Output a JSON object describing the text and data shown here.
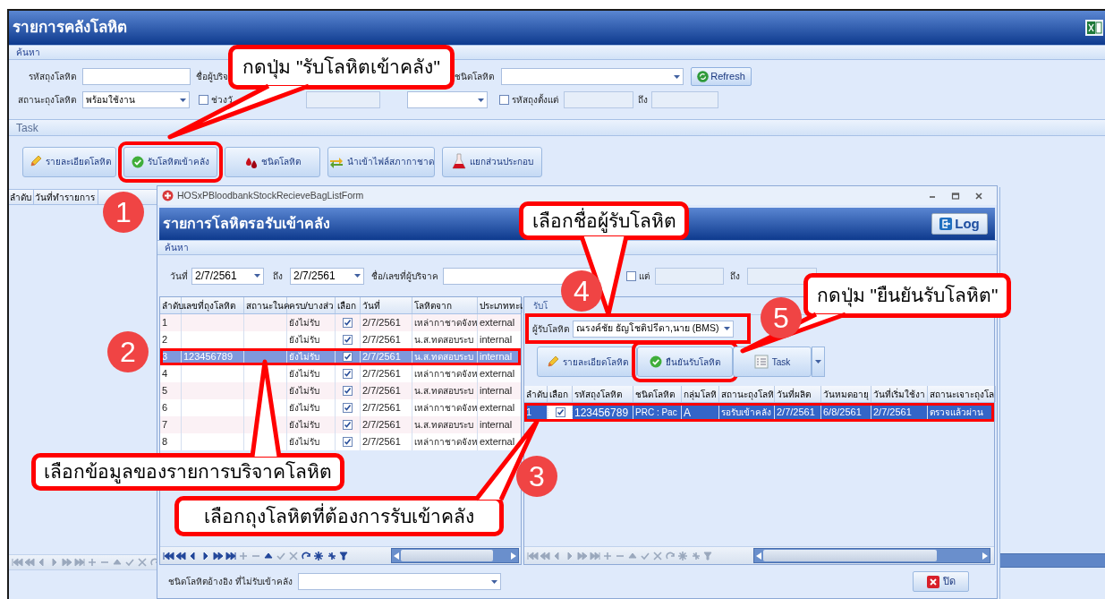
{
  "main_window": {
    "title": "รายการคลังโลหิต",
    "search_section": "ค้นหา",
    "filters": {
      "bag_code_label": "รหัสถุงโลหิต",
      "donor_label": "ชื่อผู้บริจ",
      "blood_type_label": "ชนิดโลหิต",
      "refresh_button": "Refresh",
      "bag_status_label": "สถานะถุงโลหิต",
      "bag_status_value": "พร้อมใช้งาน",
      "date_range": {
        "label": "ช่วงวั",
        "checked": false
      },
      "bag_range": {
        "label": "รหัสถุงตั้งแต่",
        "checked": false
      },
      "bag_range_to_label": "ถึง"
    },
    "task_section": "Task",
    "task_buttons": [
      {
        "kind": "pencil",
        "label": "รายละเอียดโลหิต",
        "highlighted": false
      },
      {
        "kind": "check",
        "label": "รับโลหิตเข้าคลัง",
        "highlighted": true
      },
      {
        "kind": "drop",
        "label": "ชนิดโลหิต",
        "highlighted": false
      },
      {
        "kind": "import",
        "label": "นำเข้าไฟล์สภากาชาด",
        "highlighted": false
      },
      {
        "kind": "flask",
        "label": "แยกส่วนประกอบ",
        "highlighted": false
      }
    ],
    "grid_columns": [
      "ลำดับ",
      "วันที่ทำรายการ"
    ]
  },
  "dialog": {
    "title": "HOSxPBloodbankStockRecieveBagListForm",
    "header": "รายการโลหิตรอรับเข้าคลัง",
    "log_button": "Log",
    "search_section": "ค้นหา",
    "filters": {
      "date_label": "วันที่",
      "date_from": "2/7/2561",
      "to_label": "ถึง",
      "date_to": "2/7/2561",
      "donor_label": "ชื่อ/เลขที่ผู้บริจาค",
      "bag_range": {
        "label": "แต่",
        "checked": false
      },
      "bag_range_to_label": "ถึง"
    },
    "donations": {
      "columns": [
        "ลำดับ",
        "เลขที่ถุงโลหิต",
        "สถานะในค",
        "ครบ/บางส่ว",
        "เลือก",
        "วันที่",
        "โลหิตจาก",
        "ประเภททะเ"
      ],
      "rows": [
        {
          "no": "1",
          "receive": "ยังไม่รับ",
          "checked": true,
          "date": "2/7/2561",
          "source": "เหล่ากาชาดจังห",
          "type": "external",
          "selected": false,
          "highlighted": false
        },
        {
          "no": "2",
          "receive": "ยังไม่รับ",
          "checked": true,
          "date": "2/7/2561",
          "source": "น.ส.ทดสอบระบ",
          "type": "internal",
          "selected": false,
          "highlighted": false
        },
        {
          "no": "3",
          "bag_no": "123456789",
          "receive": "ยังไม่รับ",
          "checked": true,
          "date": "2/7/2561",
          "source": "น.ส.ทดสอบระบ",
          "type": "internal",
          "selected": true,
          "highlighted": true
        },
        {
          "no": "4",
          "receive": "ยังไม่รับ",
          "checked": true,
          "date": "2/7/2561",
          "source": "เหล่ากาชาดจังห",
          "type": "external",
          "selected": false,
          "highlighted": false
        },
        {
          "no": "5",
          "receive": "ยังไม่รับ",
          "checked": true,
          "date": "2/7/2561",
          "source": "น.ส.ทดสอบระบ",
          "type": "internal",
          "selected": false,
          "highlighted": false
        },
        {
          "no": "6",
          "receive": "ยังไม่รับ",
          "checked": true,
          "date": "2/7/2561",
          "source": "เหล่ากาชาดจังห",
          "type": "external",
          "selected": false,
          "highlighted": false
        },
        {
          "no": "7",
          "receive": "ยังไม่รับ",
          "checked": true,
          "date": "2/7/2561",
          "source": "น.ส.ทดสอบระบ",
          "type": "internal",
          "selected": false,
          "highlighted": false
        },
        {
          "no": "8",
          "receive": "ยังไม่รับ",
          "checked": true,
          "date": "2/7/2561",
          "source": "เหล่ากาชาดจังห",
          "type": "external",
          "selected": false,
          "highlighted": false
        }
      ]
    },
    "receive_panel": {
      "title": "รับโ",
      "receiver_label": "ผู้รับโลหิต",
      "receiver": "ณรงค์ชัย ธัญโชติปรีดา,นาย (BMS)",
      "receiver_highlighted": true,
      "buttons": [
        {
          "kind": "pencil",
          "label": "รายละเอียดโลหิต",
          "highlighted": false
        },
        {
          "kind": "check",
          "label": "ยืนยันรับโลหิต",
          "highlighted": true
        },
        {
          "kind": "task",
          "label": "Task",
          "highlighted": false
        }
      ],
      "columns": [
        "ลำดับ",
        "เลือก",
        "รหัสถุงโลหิต",
        "ชนิดโลหิต",
        "กลุ่มโลหิ",
        "สถานะถุงโลหิ",
        "วันที่ผลิต",
        "วันหมดอายุ",
        "วันที่เริ่มใช้งา",
        "สถานะเจาะถุงโล"
      ],
      "rows": [
        {
          "no": "1",
          "checked": true,
          "bag_code": "123456789",
          "blood_type": "PRC : Pac",
          "group": "A",
          "status": "รอรับเข้าคลัง",
          "produced": "2/7/2561",
          "expires": "6/8/2561",
          "ready": "2/7/2561",
          "screening": "ตรวจแล้วผ่าน",
          "selected": true,
          "highlighted": true
        }
      ]
    },
    "reference_label": "ชนิดโลหิตอ้างอิง ที่ไม่รับเข้าคลัง",
    "close_button": "ปิด"
  },
  "annotations": {
    "steps": [
      "1",
      "2",
      "3",
      "4",
      "5"
    ],
    "notes": [
      "กดปุ่ม \"รับโลหิตเข้าคลัง\"",
      "เลือกชื่อผู้รับโลหิต",
      "กดปุ่ม \"ยืนยันรับโลหิต\"",
      "เลือกข้อมูลของรายการบริจาคโลหิต",
      "เลือกถุงโลหิตที่ต้องการรับเข้าคลัง"
    ]
  }
}
